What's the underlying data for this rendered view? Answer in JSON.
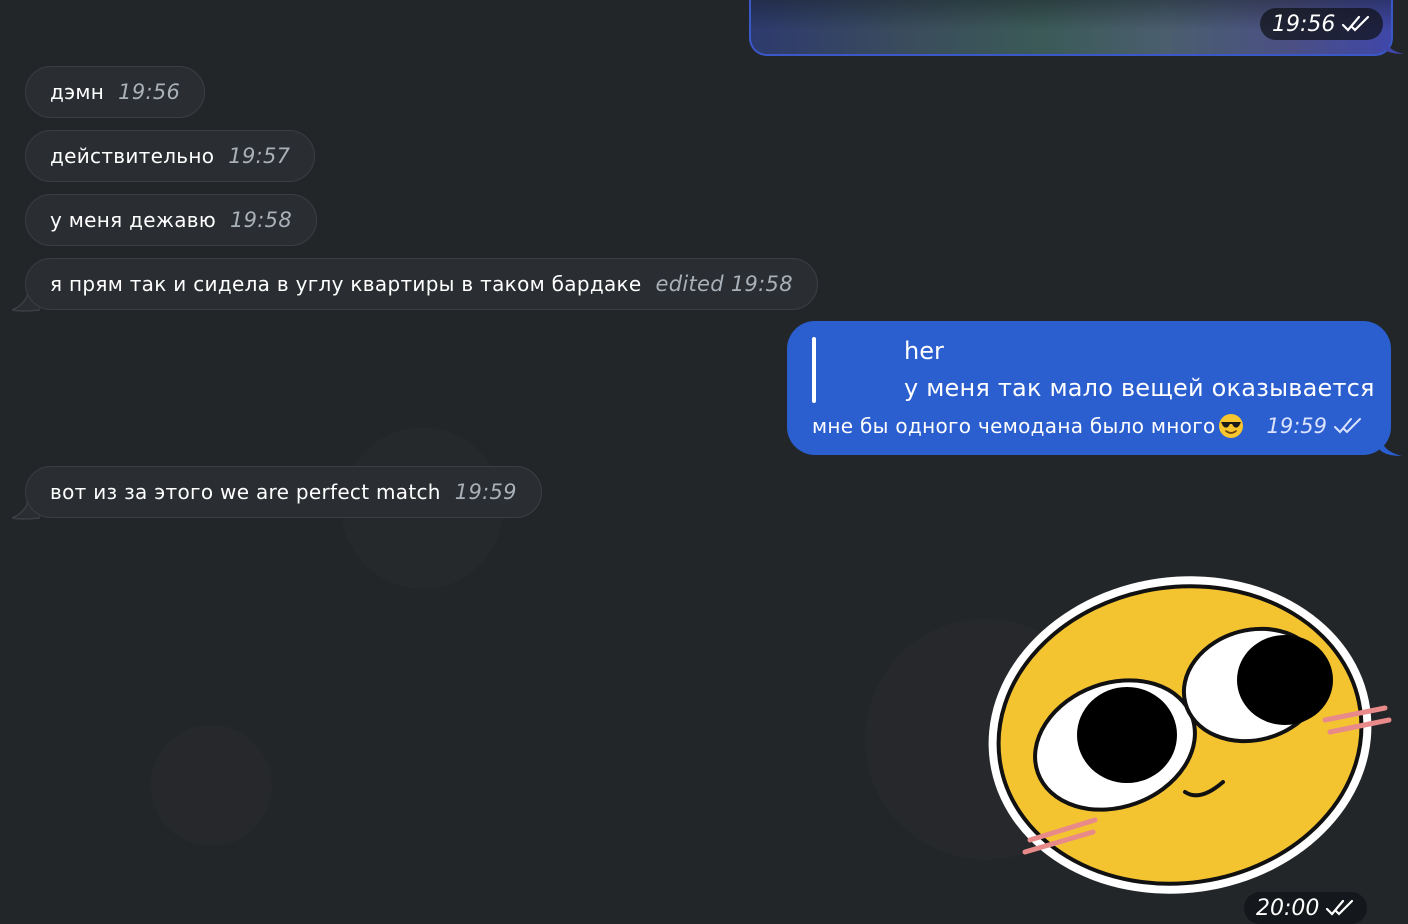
{
  "top_media": {
    "time": "19:56",
    "status": "read"
  },
  "incoming": [
    {
      "text": "дэмн",
      "time": "19:56"
    },
    {
      "text": "действительно",
      "time": "19:57"
    },
    {
      "text": "у меня дежавю",
      "time": "19:58"
    },
    {
      "text": "я прям так и сидела в углу квартиры в таком бардаке",
      "time": "edited 19:58"
    },
    {
      "text": "вот из за этого we are perfect match",
      "time": "19:59"
    }
  ],
  "outgoing_reply": {
    "quote_author": "her",
    "quote_text": "у меня так мало вещей оказывается",
    "text": "мне бы одного чемодана было много",
    "emoji": "smiling-face-with-sunglasses",
    "time": "19:59",
    "status": "read"
  },
  "sticker": {
    "name": "yellow-blushing-face-sticker",
    "time": "20:00",
    "status": "read"
  },
  "colors": {
    "background": "#232629",
    "incoming_bubble": "#2a2d31",
    "outgoing_bubble": "#2b5fd0",
    "sticker_face": "#f4c430"
  }
}
